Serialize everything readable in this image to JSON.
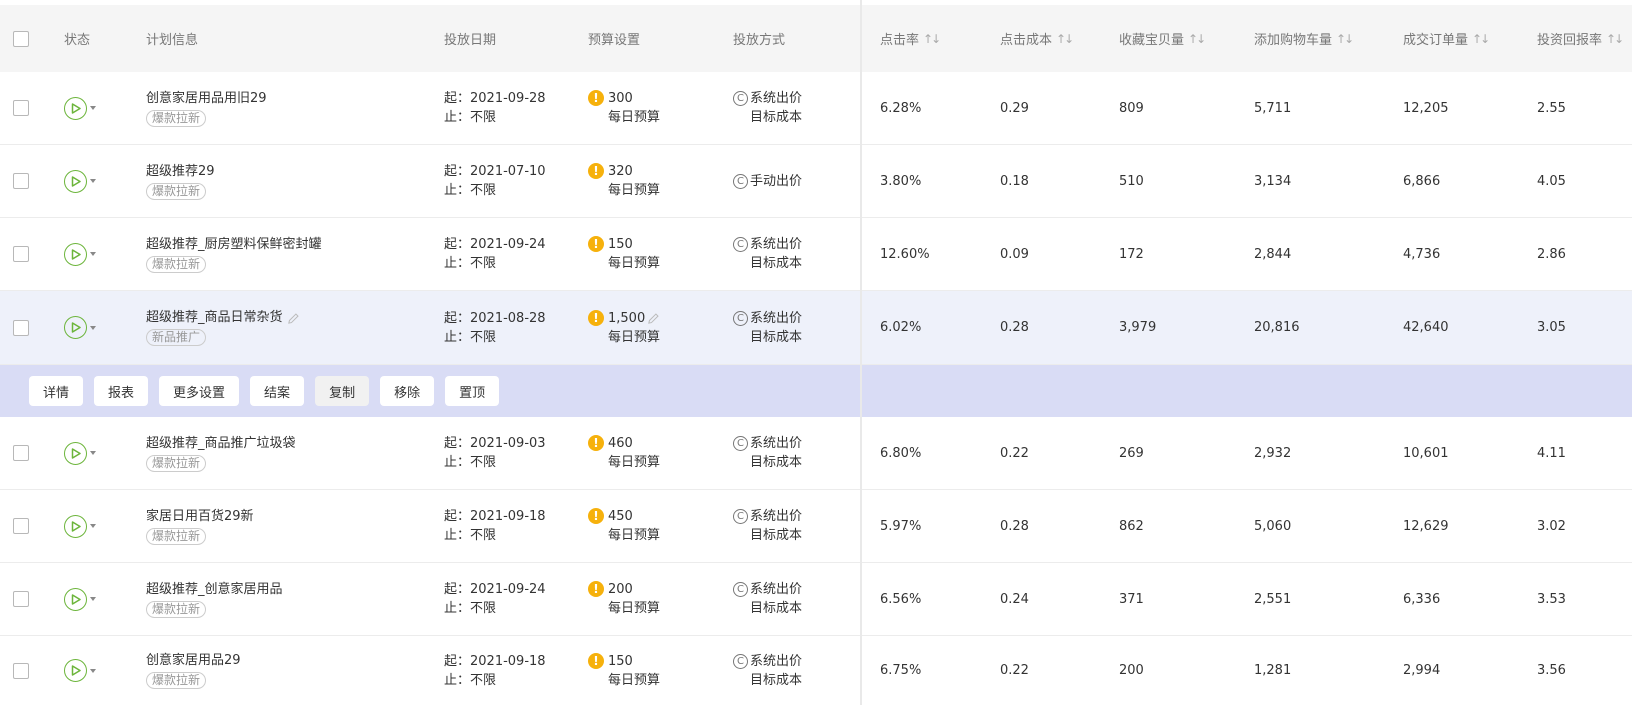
{
  "header": {
    "status": "状态",
    "plan": "计划信息",
    "date": "投放日期",
    "budget": "预算设置",
    "bid": "投放方式",
    "ctr": "点击率",
    "cpc": "点击成本",
    "fav": "收藏宝贝量",
    "cart": "添加购物车量",
    "order": "成交订单量",
    "roi": "投资回报率",
    "sort_glyph": "↑↓"
  },
  "rows": [
    {
      "name": "创意家居用品用旧29",
      "tag": "爆款拉新",
      "start": "起：2021-09-28",
      "end": "止：不限",
      "budget": "300",
      "budget_sub": "每日预算",
      "bid": "系统出价",
      "bid_sub": "目标成本",
      "ctr": "6.28%",
      "cpc": "0.29",
      "fav": "809",
      "cart": "5,711",
      "order": "12,205",
      "roi": "2.55"
    },
    {
      "name": "超级推荐29",
      "tag": "爆款拉新",
      "start": "起：2021-07-10",
      "end": "止：不限",
      "budget": "320",
      "budget_sub": "每日预算",
      "bid": "手动出价",
      "bid_sub": "",
      "ctr": "3.80%",
      "cpc": "0.18",
      "fav": "510",
      "cart": "3,134",
      "order": "6,866",
      "roi": "4.05"
    },
    {
      "name": "超级推荐_厨房塑料保鲜密封罐",
      "tag": "爆款拉新",
      "start": "起：2021-09-24",
      "end": "止：不限",
      "budget": "150",
      "budget_sub": "每日预算",
      "bid": "系统出价",
      "bid_sub": "目标成本",
      "ctr": "12.60%",
      "cpc": "0.09",
      "fav": "172",
      "cart": "2,844",
      "order": "4,736",
      "roi": "2.86"
    },
    {
      "name": "超级推荐_商品日常杂货",
      "tag": "新品推广",
      "start": "起：2021-08-28",
      "end": "止：不限",
      "budget": "1,500",
      "budget_sub": "每日预算",
      "bid": "系统出价",
      "bid_sub": "目标成本",
      "ctr": "6.02%",
      "cpc": "0.28",
      "fav": "3,979",
      "cart": "20,816",
      "order": "42,640",
      "roi": "3.05"
    },
    {
      "name": "超级推荐_商品推广垃圾袋",
      "tag": "爆款拉新",
      "start": "起：2021-09-03",
      "end": "止：不限",
      "budget": "460",
      "budget_sub": "每日预算",
      "bid": "系统出价",
      "bid_sub": "目标成本",
      "ctr": "6.80%",
      "cpc": "0.22",
      "fav": "269",
      "cart": "2,932",
      "order": "10,601",
      "roi": "4.11"
    },
    {
      "name": "家居日用百货29新",
      "tag": "爆款拉新",
      "start": "起：2021-09-18",
      "end": "止：不限",
      "budget": "450",
      "budget_sub": "每日预算",
      "bid": "系统出价",
      "bid_sub": "目标成本",
      "ctr": "5.97%",
      "cpc": "0.28",
      "fav": "862",
      "cart": "5,060",
      "order": "12,629",
      "roi": "3.02"
    },
    {
      "name": "超级推荐_创意家居用品",
      "tag": "爆款拉新",
      "start": "起：2021-09-24",
      "end": "止：不限",
      "budget": "200",
      "budget_sub": "每日预算",
      "bid": "系统出价",
      "bid_sub": "目标成本",
      "ctr": "6.56%",
      "cpc": "0.24",
      "fav": "371",
      "cart": "2,551",
      "order": "6,336",
      "roi": "3.53"
    },
    {
      "name": "创意家居用品29",
      "tag": "爆款拉新",
      "start": "起：2021-09-18",
      "end": "止：不限",
      "budget": "150",
      "budget_sub": "每日预算",
      "bid": "系统出价",
      "bid_sub": "目标成本",
      "ctr": "6.75%",
      "cpc": "0.22",
      "fav": "200",
      "cart": "1,281",
      "order": "2,994",
      "roi": "3.56"
    }
  ],
  "action_bar": {
    "detail": "详情",
    "report": "报表",
    "more": "更多设置",
    "finish": "结案",
    "copy": "复制",
    "remove": "移除",
    "top": "置顶"
  },
  "colors": {
    "play": "#6cb53b",
    "warn": "#f6b10c",
    "action_bar_bg": "#d9dcf5",
    "highlight_row_bg": "#eef1fa"
  }
}
